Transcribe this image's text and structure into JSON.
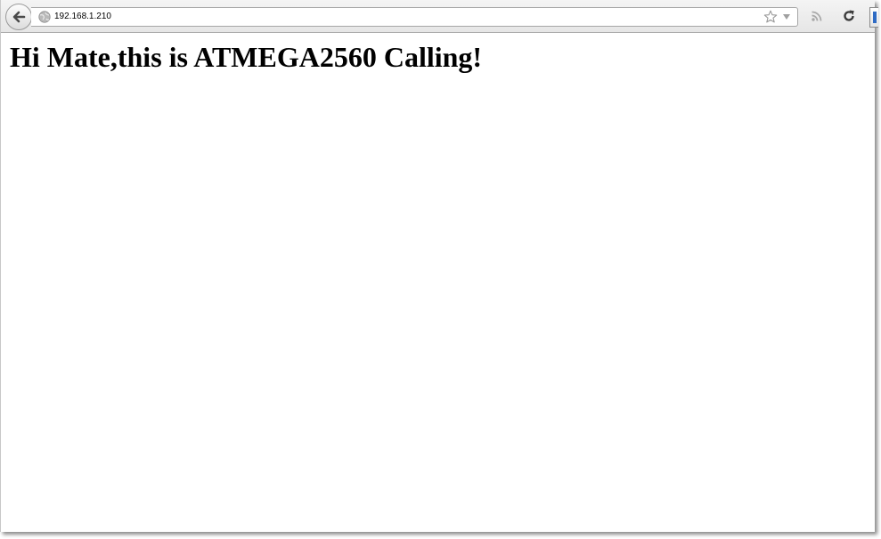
{
  "browser": {
    "url": "192.168.1.210"
  },
  "page": {
    "heading": "Hi Mate,this is ATMEGA2560 Calling!"
  },
  "icons": {
    "back": "back-arrow-icon",
    "site": "globe-icon",
    "bookmark": "star-icon",
    "history": "dropdown-arrow-icon",
    "feed": "rss-icon",
    "reload": "reload-icon"
  }
}
